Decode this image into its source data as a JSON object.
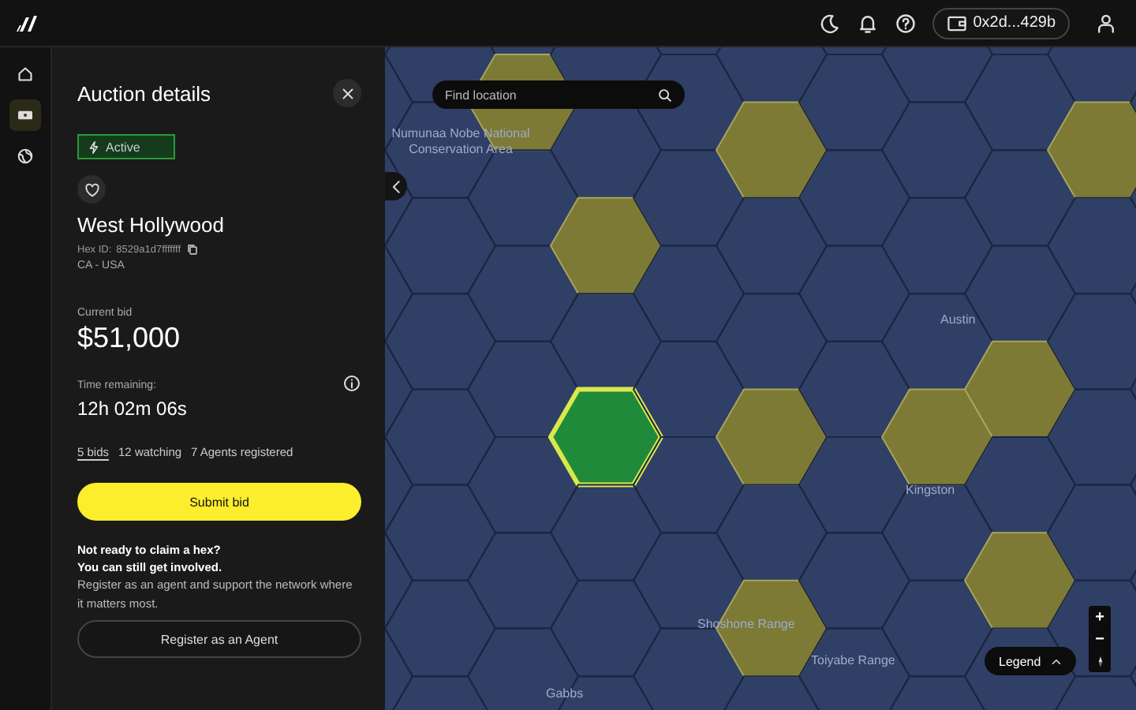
{
  "nav": {
    "items": [
      {
        "kind": "home",
        "selected": false
      },
      {
        "kind": "ticket",
        "selected": true
      },
      {
        "kind": "globe",
        "selected": false
      }
    ]
  },
  "topbar": {
    "wallet": "0x2d...429b"
  },
  "panel": {
    "title": "Auction details",
    "status": "Active",
    "name": "West Hollywood",
    "hex_id_label": "Hex ID:",
    "hex_id": "8529a1d7fffffff",
    "region": "CA - USA",
    "current_bid_label": "Current bid",
    "current_bid": "$51,000",
    "time_label": "Time remaining:",
    "time": "12h 02m 06s",
    "stats": [
      {
        "kind": "link",
        "text": "5 bids"
      },
      {
        "kind": "text",
        "text": "12 watching"
      },
      {
        "kind": "text",
        "text": "7 Agents registered"
      }
    ],
    "submit": "Submit bid",
    "promo_title": "Not ready to claim a hex?",
    "promo_subtitle": "You can still get involved.",
    "promo_text": "Register as an agent and support the network where it matters most.",
    "register": "Register as an Agent"
  },
  "map": {
    "search": {
      "placeholder": "Find location"
    },
    "labels": [
      "Numunaa Nobe National Conservation Area",
      "Austin",
      "Kingston",
      "Shoshone Range",
      "Toiyabe Range",
      "Gabbs"
    ],
    "legend": "Legend",
    "zoom_in": "+",
    "zoom_out": "−"
  }
}
